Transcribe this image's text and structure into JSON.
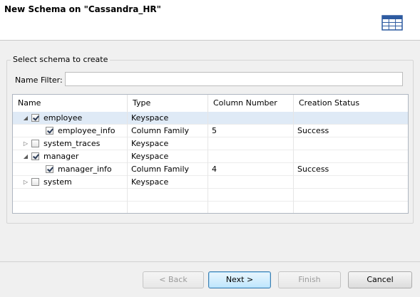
{
  "header": {
    "title": "New Schema on \"Cassandra_HR\"",
    "icon": "table-grid-icon"
  },
  "group": {
    "label": "Select schema to create"
  },
  "filter": {
    "label": "Name Filter:",
    "value": "",
    "placeholder": ""
  },
  "table": {
    "columns": [
      "Name",
      "Type",
      "Column Number",
      "Creation Status"
    ],
    "rows": [
      {
        "name": "employee",
        "type": "Keyspace",
        "column_number": "",
        "status": "",
        "checked": true,
        "expanded": true,
        "level": 0,
        "selected": true
      },
      {
        "name": "employee_info",
        "type": "Column Family",
        "column_number": "5",
        "status": "Success",
        "checked": true,
        "level": 1
      },
      {
        "name": "system_traces",
        "type": "Keyspace",
        "column_number": "",
        "status": "",
        "checked": false,
        "expanded": false,
        "level": 0
      },
      {
        "name": "manager",
        "type": "Keyspace",
        "column_number": "",
        "status": "",
        "checked": true,
        "expanded": true,
        "level": 0
      },
      {
        "name": "manager_info",
        "type": "Column Family",
        "column_number": "4",
        "status": "Success",
        "checked": true,
        "level": 1
      },
      {
        "name": "system",
        "type": "Keyspace",
        "column_number": "",
        "status": "",
        "checked": false,
        "expanded": false,
        "level": 0
      }
    ]
  },
  "buttons": {
    "back": "< Back",
    "next": "Next >",
    "finish": "Finish",
    "cancel": "Cancel"
  },
  "colors": {
    "selected_row": "#dfeaf6",
    "default_button_border": "#3c7fb1"
  }
}
